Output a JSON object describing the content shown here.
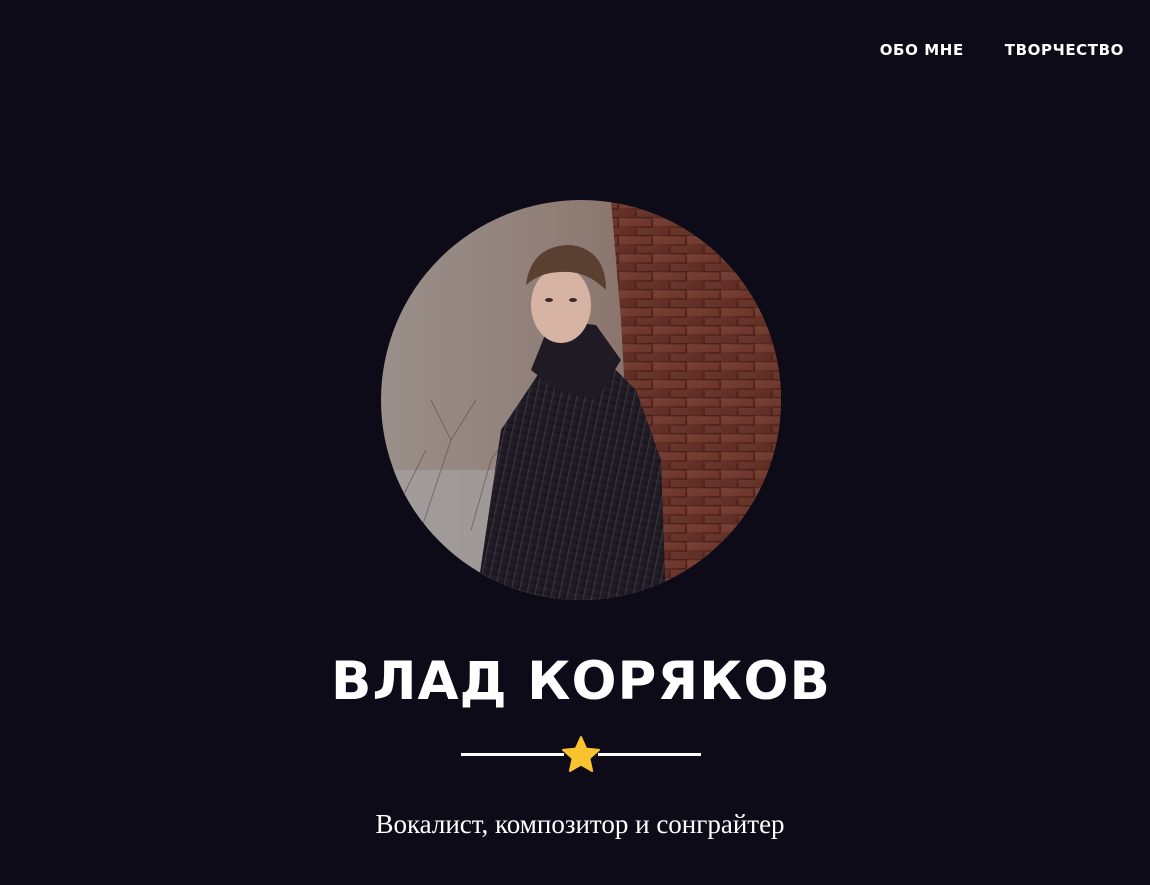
{
  "nav": {
    "items": [
      {
        "label": "ОБО МНЕ"
      },
      {
        "label": "ТВОРЧЕСТВО"
      }
    ]
  },
  "hero": {
    "name": "ВЛАД КОРЯКОВ",
    "tagline": "Вокалист, композитор и сонграйтер",
    "divider_icon": "star-icon"
  },
  "colors": {
    "background": "#0d0b18",
    "text": "#ffffff",
    "star": "#f9c22e"
  }
}
